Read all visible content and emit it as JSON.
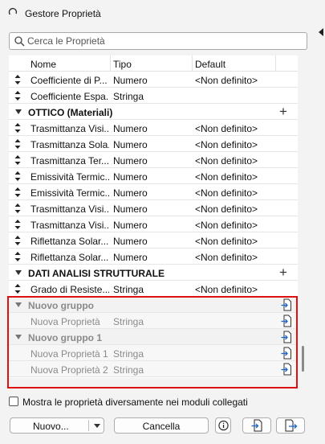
{
  "window": {
    "title": "Gestore Proprietà"
  },
  "search": {
    "placeholder": "Cerca le Proprietà",
    "value": ""
  },
  "table": {
    "columns": [
      "Nome",
      "Tipo",
      "Default"
    ],
    "rows": [
      {
        "kind": "item",
        "name": "Coefficiente di P...",
        "type": "Numero",
        "default": "<Non definito>"
      },
      {
        "kind": "item",
        "name": "Coefficiente Espa...",
        "type": "Stringa",
        "default": ""
      },
      {
        "kind": "group",
        "name": "OTTICO (Materiali)"
      },
      {
        "kind": "item",
        "name": "Trasmittanza Visi...",
        "type": "Numero",
        "default": "<Non definito>"
      },
      {
        "kind": "item",
        "name": "Trasmittanza Sola...",
        "type": "Numero",
        "default": "<Non definito>"
      },
      {
        "kind": "item",
        "name": "Trasmittanza Ter...",
        "type": "Numero",
        "default": "<Non definito>"
      },
      {
        "kind": "item",
        "name": "Emissività Termic...",
        "type": "Numero",
        "default": "<Non definito>"
      },
      {
        "kind": "item",
        "name": "Emissività Termic...",
        "type": "Numero",
        "default": "<Non definito>"
      },
      {
        "kind": "item",
        "name": "Trasmittanza Visi...",
        "type": "Numero",
        "default": "<Non definito>"
      },
      {
        "kind": "item",
        "name": "Trasmittanza Visi...",
        "type": "Numero",
        "default": "<Non definito>"
      },
      {
        "kind": "item",
        "name": "Riflettanza Solar...",
        "type": "Numero",
        "default": "<Non definito>"
      },
      {
        "kind": "item",
        "name": "Riflettanza Solar...",
        "type": "Numero",
        "default": "<Non definito>"
      },
      {
        "kind": "group",
        "name": "DATI ANALISI STRUTTURALE"
      },
      {
        "kind": "item",
        "name": "Grado di Resiste...",
        "type": "Stringa",
        "default": "<Non definito>"
      },
      {
        "kind": "new-group",
        "name": "Nuovo gruppo"
      },
      {
        "kind": "new-item",
        "name": "Nuova Proprietà",
        "type": "Stringa",
        "default": ""
      },
      {
        "kind": "new-group",
        "name": "Nuovo gruppo 1"
      },
      {
        "kind": "new-item",
        "name": "Nuova Proprietà 1",
        "type": "Stringa",
        "default": ""
      },
      {
        "kind": "new-item",
        "name": "Nuova Proprietà 2",
        "type": "Stringa",
        "default": ""
      }
    ]
  },
  "options": {
    "show_linked_label": "Mostra le proprietà diversamente nei moduli collegati",
    "show_linked_checked": false
  },
  "buttons": {
    "new_label": "Nuovo...",
    "cancel_label": "Cancella"
  },
  "icons": {
    "title": "spinner-icon",
    "search": "search-icon",
    "drag": "drag-handle-icon",
    "expand": "triangle-down-icon",
    "add": "plus-icon",
    "import": "import-file-icon",
    "info": "info-icon",
    "export": "export-icon"
  },
  "colors": {
    "highlight": "#dd1111",
    "accent": "#1a64c8"
  }
}
